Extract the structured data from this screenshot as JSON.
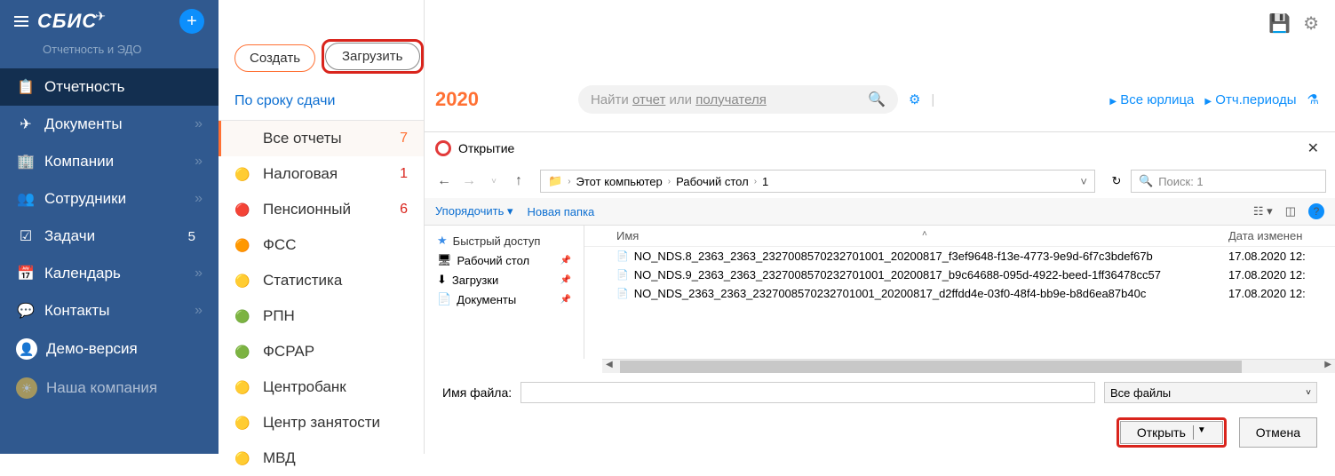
{
  "sidebar": {
    "logo": "СБИС",
    "subtitle": "Отчетность и ЭДО",
    "items": [
      {
        "label": "Отчетность",
        "icon": "📋",
        "active": true
      },
      {
        "label": "Документы",
        "icon": "✈",
        "chevron": true
      },
      {
        "label": "Компании",
        "icon": "🏢",
        "chevron": true
      },
      {
        "label": "Сотрудники",
        "icon": "👥",
        "chevron": true
      },
      {
        "label": "Задачи",
        "icon": "☑",
        "badge": "5"
      },
      {
        "label": "Календарь",
        "icon": "📅",
        "chevron": true
      },
      {
        "label": "Контакты",
        "icon": "💬",
        "chevron": true
      }
    ],
    "demo": "Демо-версия",
    "company": "Наша компания"
  },
  "topButtons": {
    "create": "Создать",
    "load": "Загрузить"
  },
  "catHeader": "По сроку сдачи",
  "categories": [
    {
      "label": "Все отчеты",
      "count": "7",
      "countClass": "orange",
      "active": true,
      "icon": ""
    },
    {
      "label": "Налоговая",
      "count": "1",
      "countClass": "red",
      "icon": "🟡"
    },
    {
      "label": "Пенсионный",
      "count": "6",
      "countClass": "red",
      "icon": "🔴"
    },
    {
      "label": "ФСС",
      "icon": "🟠"
    },
    {
      "label": "Статистика",
      "icon": "🟡"
    },
    {
      "label": "РПН",
      "icon": "🟢"
    },
    {
      "label": "ФСРАР",
      "icon": "🟢"
    },
    {
      "label": "Центробанк",
      "icon": "🟡"
    },
    {
      "label": "Центр занятости",
      "icon": "🟡"
    },
    {
      "label": "МВД",
      "icon": "🟡"
    }
  ],
  "main": {
    "year": "2020",
    "search_prefix": "Найти ",
    "search_link1": "отчет",
    "search_mid": " или ",
    "search_link2": "получателя",
    "all_legal": "Все юрлица",
    "periods": "Отч.периоды"
  },
  "fileDialog": {
    "title": "Открытие",
    "path": {
      "p1": "Этот компьютер",
      "p2": "Рабочий стол",
      "p3": "1"
    },
    "search_placeholder": "Поиск: 1",
    "sort": "Упорядочить",
    "newFolder": "Новая папка",
    "tree": [
      {
        "label": "Быстрый доступ",
        "icon": "★",
        "iconClass": "star",
        "class": "quick"
      },
      {
        "label": "Рабочий стол",
        "icon": "🖥",
        "pin": true
      },
      {
        "label": "Загрузки",
        "icon": "⬇",
        "pin": true
      },
      {
        "label": "Документы",
        "icon": "📄",
        "pin": true
      }
    ],
    "cols": {
      "name": "Имя",
      "date": "Дата изменен"
    },
    "files": [
      {
        "name": "NO_NDS.8_2363_2363_2327008570232701001_20200817_f3ef9648-f13e-4773-9e9d-6f7c3bdef67b",
        "date": "17.08.2020 12:"
      },
      {
        "name": "NO_NDS.9_2363_2363_2327008570232701001_20200817_b9c64688-095d-4922-beed-1ff36478cc57",
        "date": "17.08.2020 12:"
      },
      {
        "name": "NO_NDS_2363_2363_2327008570232701001_20200817_d2ffdd4e-03f0-48f4-bb9e-b8d6ea87b40c",
        "date": "17.08.2020 12:"
      }
    ],
    "filenameLabel": "Имя файла:",
    "fileType": "Все файлы",
    "open": "Открыть",
    "cancel": "Отмена"
  }
}
